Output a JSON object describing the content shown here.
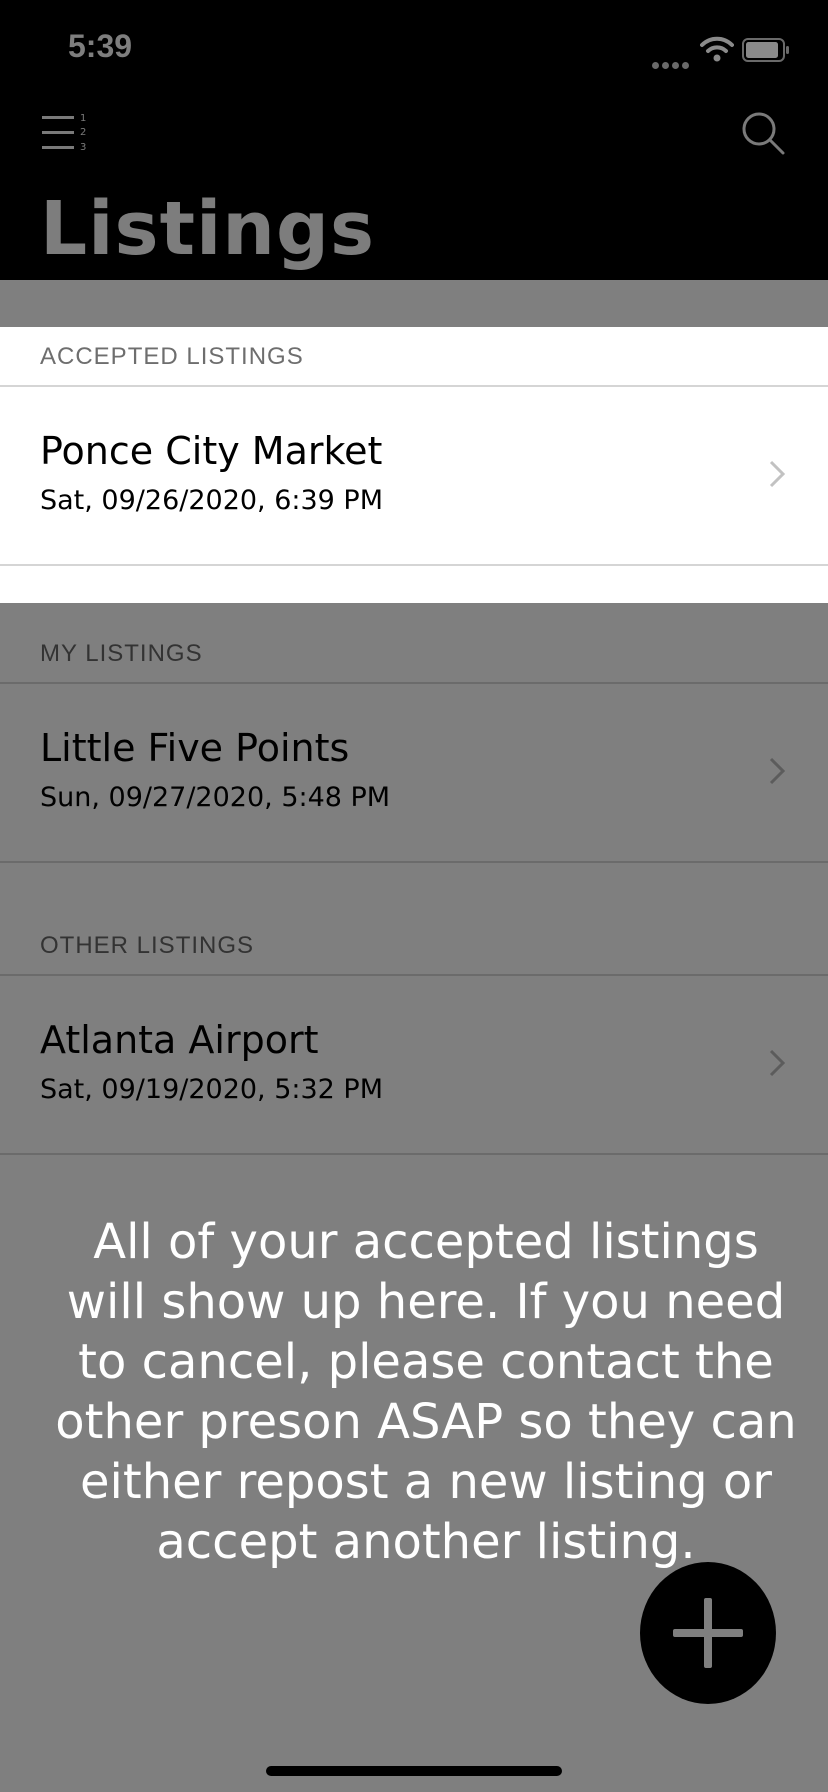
{
  "status_bar": {
    "time": "5:39"
  },
  "header": {
    "title": "Listings",
    "menu_icon": "numbered-list-icon",
    "search_icon": "search-icon"
  },
  "sections": {
    "accepted": {
      "label": "ACCEPTED LISTINGS",
      "items": [
        {
          "title": "Ponce City Market",
          "subtitle": "Sat, 09/26/2020, 6:39 PM"
        }
      ]
    },
    "mine": {
      "label": "MY LISTINGS",
      "items": [
        {
          "title": "Little Five Points",
          "subtitle": "Sun, 09/27/2020, 5:48 PM"
        }
      ]
    },
    "other": {
      "label": "OTHER LISTINGS",
      "items": [
        {
          "title": "Atlanta Airport",
          "subtitle": "Sat, 09/19/2020, 5:32 PM"
        }
      ]
    }
  },
  "overlay": {
    "message": "All of your accepted listings will show up here. If you need to cancel, please contact the other preson ASAP so they can either repost a new listing or accept another listing."
  },
  "fab": {
    "icon": "plus-icon"
  }
}
